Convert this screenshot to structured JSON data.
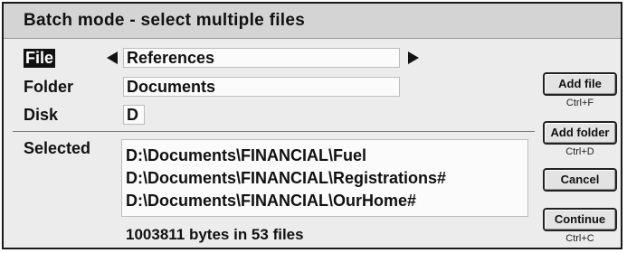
{
  "dialog": {
    "title": "Batch mode - select multiple files"
  },
  "fields": {
    "file": {
      "label": "File",
      "value": "References"
    },
    "folder": {
      "label": "Folder",
      "value": "Documents"
    },
    "disk": {
      "label": "Disk",
      "value": "D"
    }
  },
  "selected": {
    "label": "Selected",
    "items": [
      "D:\\Documents\\FINANCIAL\\Fuel",
      "D:\\Documents\\FINANCIAL\\Registrations#",
      "D:\\Documents\\FINANCIAL\\OurHome#"
    ],
    "summary": "1003811 bytes in 53 files"
  },
  "buttons": [
    {
      "label": "Add file",
      "shortcut": "Ctrl+F"
    },
    {
      "label": "Add folder",
      "shortcut": "Ctrl+D"
    },
    {
      "label": "Cancel",
      "shortcut": ""
    },
    {
      "label": "Continue",
      "shortcut": "Ctrl+C"
    }
  ],
  "icons": {
    "previous": "left-arrow-icon",
    "next": "right-arrow-icon"
  }
}
